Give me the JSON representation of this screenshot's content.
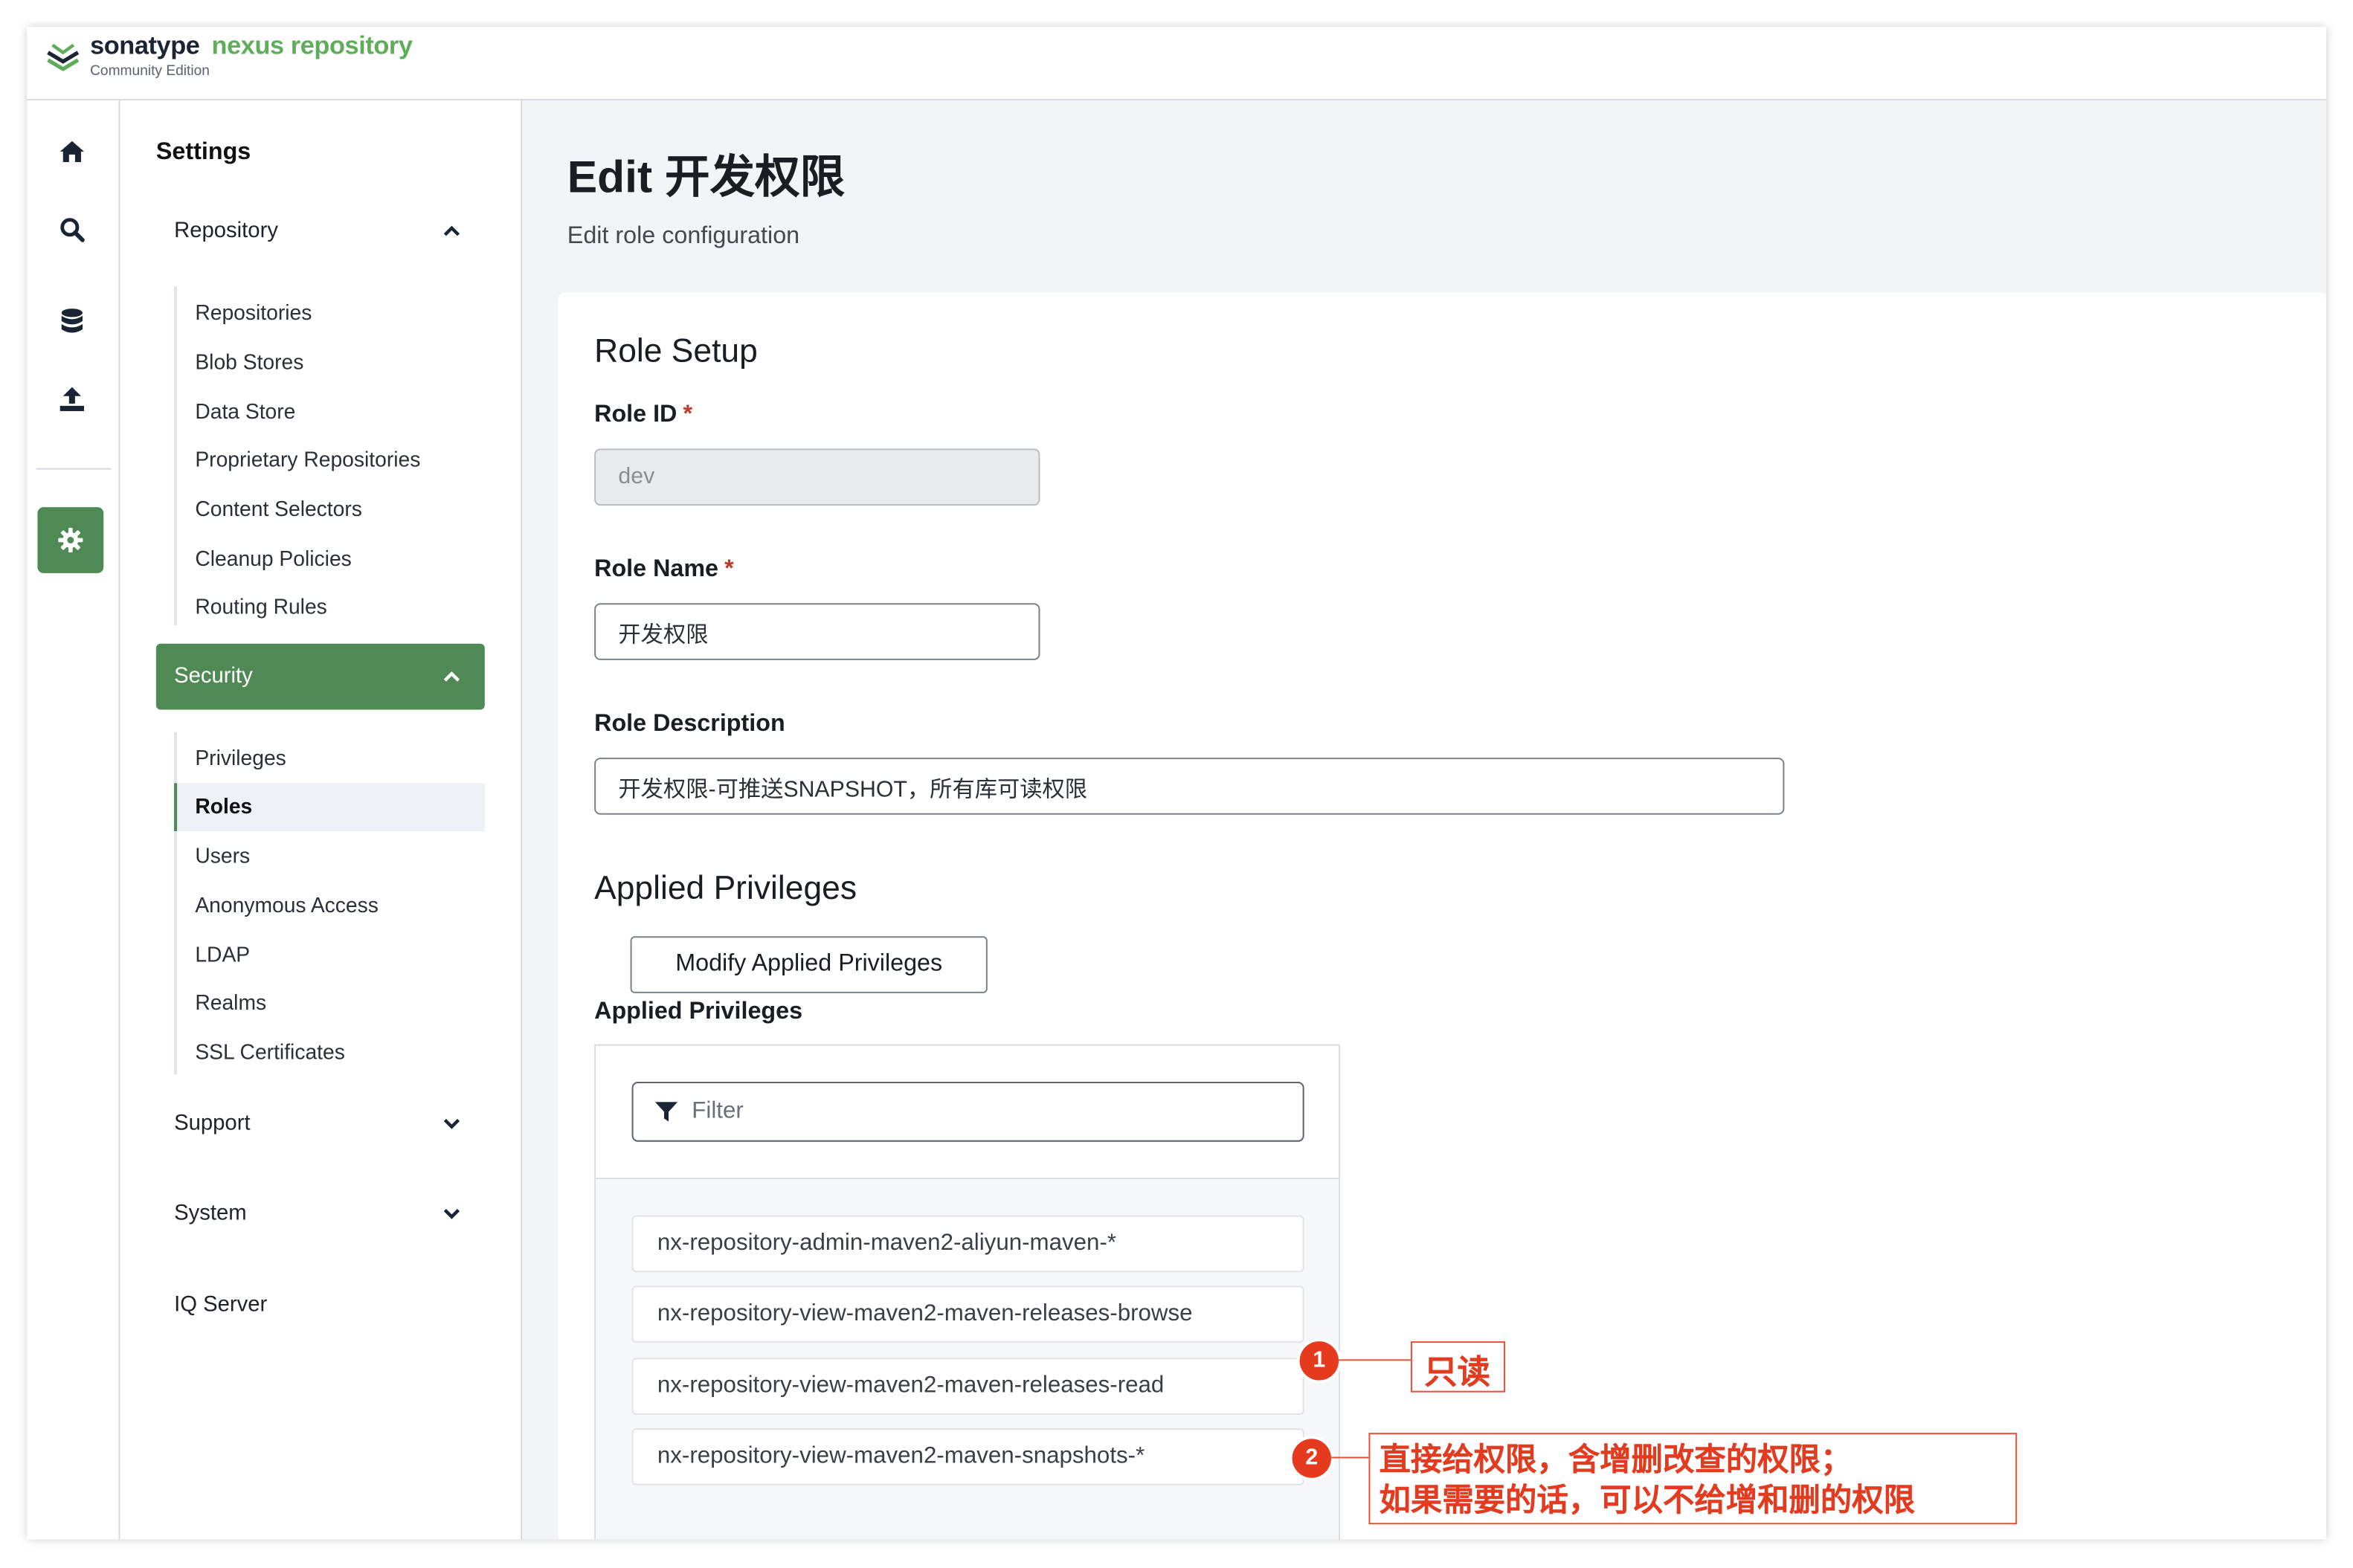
{
  "brand": {
    "name_primary": "sonatype",
    "name_secondary": "nexus repository",
    "edition": "Community Edition"
  },
  "rail": {
    "icons": [
      "home-icon",
      "search-icon",
      "database-icon",
      "upload-icon",
      "gear-icon"
    ]
  },
  "sidebar": {
    "title": "Settings",
    "groups": [
      {
        "label": "Repository",
        "expanded": true,
        "items": [
          "Repositories",
          "Blob Stores",
          "Data Store",
          "Proprietary Repositories",
          "Content Selectors",
          "Cleanup Policies",
          "Routing Rules"
        ]
      },
      {
        "label": "Security",
        "expanded": true,
        "active": true,
        "items": [
          "Privileges",
          "Roles",
          "Users",
          "Anonymous Access",
          "LDAP",
          "Realms",
          "SSL Certificates"
        ],
        "selected": "Roles"
      },
      {
        "label": "Support",
        "expanded": false
      },
      {
        "label": "System",
        "expanded": false
      },
      {
        "label": "IQ Server"
      }
    ]
  },
  "main": {
    "title": "Edit 开发权限",
    "subtitle": "Edit role configuration",
    "section_setup": "Role Setup",
    "role_id": {
      "label": "Role ID",
      "required": "*",
      "value": "dev"
    },
    "role_name": {
      "label": "Role Name",
      "required": "*",
      "value": "开发权限"
    },
    "role_description": {
      "label": "Role Description",
      "value": "开发权限-可推送SNAPSHOT，所有库可读权限"
    },
    "section_privileges": "Applied Privileges",
    "modify_button": "Modify Applied Privileges",
    "privileges_label": "Applied Privileges",
    "filter_placeholder": "Filter",
    "privileges": [
      "nx-repository-admin-maven2-aliyun-maven-*",
      "nx-repository-view-maven2-maven-releases-browse",
      "nx-repository-view-maven2-maven-releases-read",
      "nx-repository-view-maven2-maven-snapshots-*"
    ]
  },
  "annotations": [
    {
      "number": "1",
      "text": "只读"
    },
    {
      "number": "2",
      "line1": "直接给权限，含增删改查的权限；",
      "line2": "如果需要的话，可以不给增和删的权限"
    }
  ],
  "colors": {
    "accent": "#4f8a55",
    "brand_green": "#5fad5a",
    "annotation_red": "#e53a1e"
  }
}
